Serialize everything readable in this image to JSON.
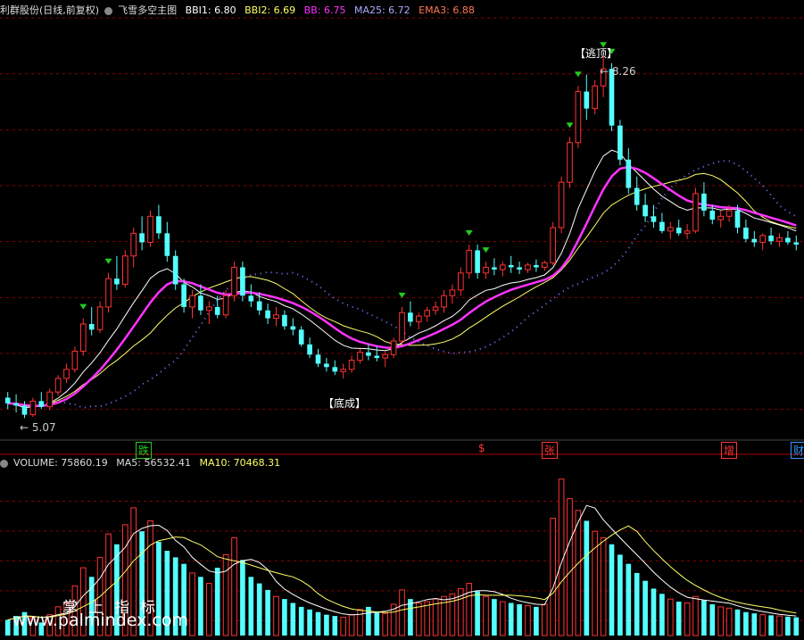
{
  "main_header": {
    "stock": "利群股份(日线,前复权)",
    "indicator": "飞雪多空主图",
    "bbi1_label": "BBI1: 6.80",
    "bbi2_label": "BBI2: 6.69",
    "bb_label": "BB: 6.75",
    "ma25_label": "MA25: 6.72",
    "ema3_label": "EMA3: 6.88"
  },
  "vol_header": {
    "volume_label": "VOLUME: 75860.19",
    "ma5_label": "MA5: 56532.41",
    "ma10_label": "MA10: 70468.31"
  },
  "annotations": {
    "high_price": "8.26",
    "low_price": "5.07",
    "top_signal": "【逃顶】",
    "bottom_signal": "【底成】"
  },
  "event_markers": [
    {
      "label": "跌",
      "color": "#22cc22"
    },
    {
      "label": "$",
      "color": "#ff3333"
    },
    {
      "label": "张",
      "color": "#ff3333"
    },
    {
      "label": "增",
      "color": "#ff3333"
    },
    {
      "label": "财",
      "color": "#3399ff"
    }
  ],
  "watermark": {
    "cn": "掌上指标",
    "url": "www.palmindex.com"
  },
  "colors": {
    "up": "#ff3333",
    "down": "#54ffff",
    "bb_magenta": "#ff33ff",
    "bbi1_white": "#ffffff",
    "bbi2_yellow": "#ffff66",
    "ema_dots": "#7777ff",
    "grid": "#8b0000",
    "signal_green": "#22cc22"
  },
  "chart_data": {
    "type": "candlestick",
    "title": "飞雪多空主图",
    "price_range": [
      4.9,
      8.6
    ],
    "candles": [
      [
        5.25,
        5.3,
        5.15,
        5.2
      ],
      [
        5.2,
        5.28,
        5.12,
        5.18
      ],
      [
        5.18,
        5.22,
        5.07,
        5.1
      ],
      [
        5.1,
        5.25,
        5.08,
        5.22
      ],
      [
        5.22,
        5.3,
        5.15,
        5.17
      ],
      [
        5.17,
        5.33,
        5.14,
        5.3
      ],
      [
        5.3,
        5.45,
        5.27,
        5.42
      ],
      [
        5.42,
        5.55,
        5.38,
        5.5
      ],
      [
        5.5,
        5.7,
        5.47,
        5.66
      ],
      [
        5.66,
        5.95,
        5.62,
        5.9
      ],
      [
        5.9,
        6.05,
        5.8,
        5.85
      ],
      [
        5.85,
        6.1,
        5.82,
        6.05
      ],
      [
        6.05,
        6.35,
        6.0,
        6.3
      ],
      [
        6.3,
        6.5,
        6.2,
        6.25
      ],
      [
        6.25,
        6.55,
        6.22,
        6.5
      ],
      [
        6.5,
        6.75,
        6.4,
        6.7
      ],
      [
        6.7,
        6.85,
        6.55,
        6.62
      ],
      [
        6.62,
        6.9,
        6.58,
        6.85
      ],
      [
        6.85,
        6.95,
        6.65,
        6.7
      ],
      [
        6.7,
        6.8,
        6.45,
        6.5
      ],
      [
        6.5,
        6.55,
        6.2,
        6.25
      ],
      [
        6.25,
        6.3,
        6.0,
        6.05
      ],
      [
        6.05,
        6.2,
        5.95,
        6.15
      ],
      [
        6.15,
        6.25,
        5.98,
        6.02
      ],
      [
        6.02,
        6.1,
        5.9,
        6.05
      ],
      [
        6.05,
        6.15,
        5.95,
        5.98
      ],
      [
        5.98,
        6.2,
        5.95,
        6.15
      ],
      [
        6.15,
        6.45,
        6.1,
        6.4
      ],
      [
        6.4,
        6.45,
        6.1,
        6.15
      ],
      [
        6.15,
        6.25,
        6.05,
        6.1
      ],
      [
        6.1,
        6.18,
        5.98,
        6.02
      ],
      [
        6.02,
        6.08,
        5.9,
        5.95
      ],
      [
        5.95,
        6.05,
        5.88,
        5.98
      ],
      [
        5.98,
        6.02,
        5.85,
        5.88
      ],
      [
        5.88,
        5.95,
        5.8,
        5.85
      ],
      [
        5.85,
        5.88,
        5.7,
        5.72
      ],
      [
        5.72,
        5.78,
        5.6,
        5.63
      ],
      [
        5.63,
        5.68,
        5.52,
        5.55
      ],
      [
        5.55,
        5.6,
        5.48,
        5.52
      ],
      [
        5.52,
        5.58,
        5.45,
        5.48
      ],
      [
        5.48,
        5.55,
        5.42,
        5.5
      ],
      [
        5.5,
        5.62,
        5.47,
        5.58
      ],
      [
        5.58,
        5.68,
        5.55,
        5.65
      ],
      [
        5.65,
        5.72,
        5.58,
        5.62
      ],
      [
        5.62,
        5.7,
        5.57,
        5.6
      ],
      [
        5.6,
        5.66,
        5.52,
        5.63
      ],
      [
        5.63,
        5.78,
        5.6,
        5.75
      ],
      [
        5.75,
        6.05,
        5.72,
        6.0
      ],
      [
        6.0,
        6.1,
        5.88,
        5.92
      ],
      [
        5.92,
        6.0,
        5.85,
        5.97
      ],
      [
        5.97,
        6.05,
        5.92,
        6.02
      ],
      [
        6.02,
        6.1,
        5.98,
        6.05
      ],
      [
        6.05,
        6.2,
        6.0,
        6.15
      ],
      [
        6.15,
        6.25,
        6.08,
        6.2
      ],
      [
        6.2,
        6.4,
        6.15,
        6.35
      ],
      [
        6.35,
        6.6,
        6.3,
        6.55
      ],
      [
        6.55,
        6.6,
        6.3,
        6.35
      ],
      [
        6.35,
        6.45,
        6.3,
        6.4
      ],
      [
        6.4,
        6.48,
        6.33,
        6.38
      ],
      [
        6.38,
        6.45,
        6.32,
        6.42
      ],
      [
        6.42,
        6.5,
        6.35,
        6.4
      ],
      [
        6.4,
        6.45,
        6.34,
        6.38
      ],
      [
        6.38,
        6.44,
        6.35,
        6.42
      ],
      [
        6.42,
        6.47,
        6.36,
        6.4
      ],
      [
        6.4,
        6.46,
        6.37,
        6.44
      ],
      [
        6.44,
        6.8,
        6.42,
        6.75
      ],
      [
        6.75,
        7.2,
        6.7,
        7.15
      ],
      [
        7.15,
        7.55,
        7.1,
        7.5
      ],
      [
        7.5,
        8.0,
        7.45,
        7.95
      ],
      [
        7.95,
        8.1,
        7.7,
        7.8
      ],
      [
        7.8,
        8.05,
        7.75,
        8.0
      ],
      [
        8.0,
        8.26,
        7.9,
        8.15
      ],
      [
        8.15,
        8.2,
        7.6,
        7.65
      ],
      [
        7.65,
        7.7,
        7.3,
        7.35
      ],
      [
        7.35,
        7.45,
        7.05,
        7.1
      ],
      [
        7.1,
        7.2,
        6.9,
        6.95
      ],
      [
        6.95,
        7.05,
        6.8,
        6.85
      ],
      [
        6.85,
        6.95,
        6.75,
        6.8
      ],
      [
        6.8,
        6.88,
        6.7,
        6.72
      ],
      [
        6.72,
        6.8,
        6.65,
        6.75
      ],
      [
        6.75,
        6.82,
        6.68,
        6.7
      ],
      [
        6.7,
        6.78,
        6.65,
        6.72
      ],
      [
        6.72,
        7.1,
        6.7,
        7.05
      ],
      [
        7.05,
        7.15,
        6.85,
        6.9
      ],
      [
        6.9,
        6.95,
        6.78,
        6.82
      ],
      [
        6.82,
        6.9,
        6.75,
        6.85
      ],
      [
        6.85,
        6.95,
        6.8,
        6.9
      ],
      [
        6.9,
        6.95,
        6.7,
        6.75
      ],
      [
        6.75,
        6.82,
        6.62,
        6.65
      ],
      [
        6.65,
        6.72,
        6.58,
        6.62
      ],
      [
        6.62,
        6.7,
        6.55,
        6.68
      ],
      [
        6.68,
        6.75,
        6.6,
        6.63
      ],
      [
        6.63,
        6.7,
        6.58,
        6.66
      ],
      [
        6.66,
        6.72,
        6.6,
        6.62
      ],
      [
        6.62,
        6.68,
        6.55,
        6.6
      ]
    ],
    "volume": [
      12000,
      15000,
      18000,
      14000,
      10000,
      16000,
      22000,
      25000,
      38000,
      52000,
      45000,
      60000,
      78000,
      70000,
      85000,
      98000,
      80000,
      88000,
      72000,
      65000,
      60000,
      55000,
      48000,
      45000,
      40000,
      52000,
      62000,
      75000,
      58000,
      45000,
      40000,
      35000,
      30000,
      28000,
      25000,
      22000,
      20000,
      18000,
      16000,
      15000,
      14000,
      16000,
      20000,
      22000,
      18000,
      17000,
      24000,
      35000,
      28000,
      25000,
      26000,
      28000,
      30000,
      32000,
      36000,
      40000,
      34000,
      30000,
      28000,
      26000,
      25000,
      24000,
      23000,
      22000,
      24000,
      90000,
      120000,
      105000,
      96000,
      88000,
      80000,
      75000,
      70000,
      62000,
      55000,
      48000,
      42000,
      36000,
      32000,
      28000,
      26000,
      25000,
      30000,
      27000,
      24000,
      22000,
      21000,
      20000,
      18000,
      17000,
      16000,
      15500,
      15000,
      14500,
      14000
    ],
    "y_labels": {
      "vol_ma5": "MA5",
      "vol_ma10": "MA10"
    }
  }
}
